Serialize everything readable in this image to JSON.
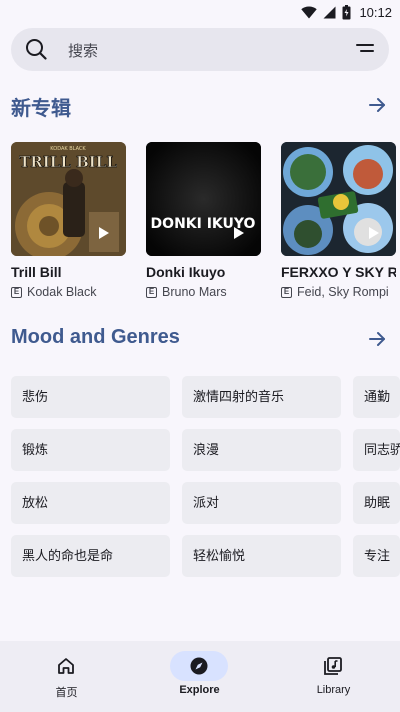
{
  "status_bar": {
    "time": "10:12"
  },
  "search": {
    "placeholder": "搜索"
  },
  "new_albums": {
    "title": "新专辑",
    "items": [
      {
        "title": "Trill Bill",
        "artist": "Kodak Black",
        "cover_text": "TRILL BILL",
        "cover_subtext": "KODAK BLACK",
        "explicit": "E"
      },
      {
        "title": "Donki Ikuyo",
        "artist": "Bruno Mars",
        "cover_text": "DONKI IKUYO",
        "explicit": "E"
      },
      {
        "title": "FERXXO Y SKY R",
        "artist": "Feid, Sky Rompi",
        "explicit": "E"
      }
    ]
  },
  "moods": {
    "title": "Mood and Genres",
    "items": [
      "悲伤",
      "激情四射的音乐",
      "通勤",
      "锻炼",
      "浪漫",
      "同志骄",
      "放松",
      "派对",
      "助眠",
      "黑人的命也是命",
      "轻松愉悦",
      "专注"
    ]
  },
  "nav": {
    "items": [
      {
        "label": "首页",
        "icon": "home-icon"
      },
      {
        "label": "Explore",
        "icon": "compass-icon"
      },
      {
        "label": "Library",
        "icon": "library-icon"
      }
    ],
    "active": "Explore"
  },
  "colors": {
    "accent": "#3f5a8f",
    "background": "#f8f6fc",
    "chip": "#ececf1",
    "nav_indicator": "#d8e2ff"
  }
}
